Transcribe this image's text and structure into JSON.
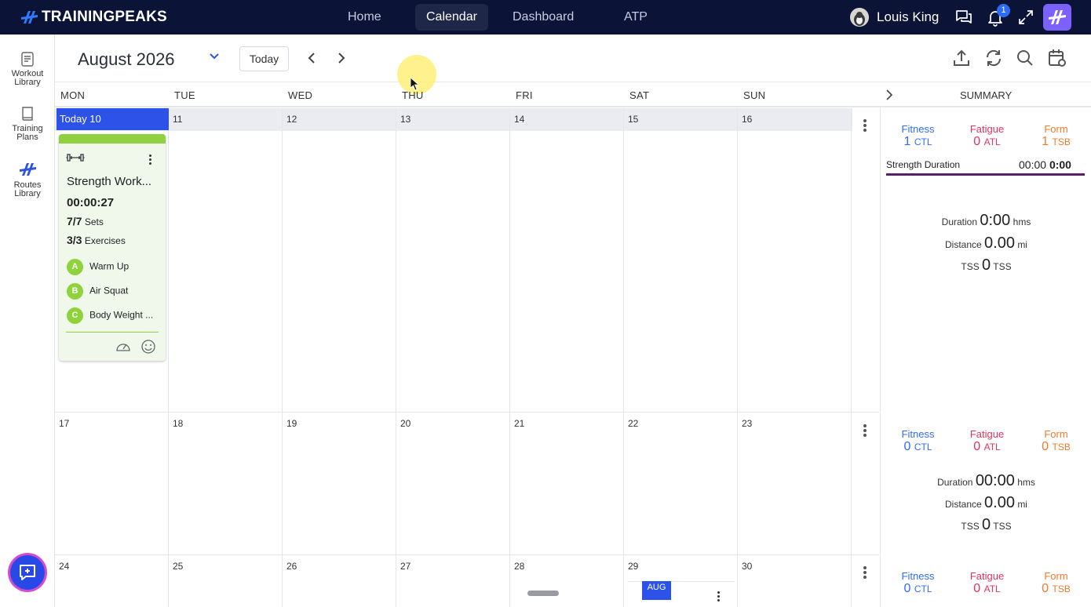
{
  "brand": {
    "name": "TRAININGPEAKS",
    "accent": "#2f6cf6"
  },
  "nav": {
    "items": [
      {
        "label": "Home",
        "active": false
      },
      {
        "label": "Calendar",
        "active": true
      },
      {
        "label": "Dashboard",
        "active": false
      },
      {
        "label": "ATP",
        "active": false
      }
    ],
    "user_name": "Louis King",
    "notification_count": "1"
  },
  "rail": {
    "items": [
      {
        "label_1": "Workout",
        "label_2": "Library",
        "icon": "workout-library-icon"
      },
      {
        "label_1": "Training",
        "label_2": "Plans",
        "icon": "book-icon"
      },
      {
        "label_1": "Routes",
        "label_2": "Library",
        "icon": "routes-icon"
      }
    ]
  },
  "toolbar": {
    "month": "August 2026",
    "today_label": "Today"
  },
  "days": [
    "MON",
    "TUE",
    "WED",
    "THU",
    "FRI",
    "SAT",
    "SUN"
  ],
  "summary_label": "SUMMARY",
  "weeks": [
    {
      "dates": [
        "Today 10",
        "11",
        "12",
        "13",
        "14",
        "15",
        "16"
      ],
      "fitness": "1",
      "fatigue": "0",
      "form": "1",
      "duration": "0:00",
      "distance": "0.00",
      "tss": "0",
      "strength_label": "Strength Duration",
      "strength_value": "00:00",
      "strength_total": "0:00"
    },
    {
      "dates": [
        "17",
        "18",
        "19",
        "20",
        "21",
        "22",
        "23"
      ],
      "fitness": "0",
      "fatigue": "0",
      "form": "0",
      "duration": "00:00",
      "distance": "0.00",
      "tss": "0"
    },
    {
      "dates": [
        "24",
        "25",
        "26",
        "27",
        "28",
        "29",
        "30"
      ],
      "fitness": "0",
      "fatigue": "0",
      "form": "0"
    }
  ],
  "metric_labels": {
    "fitness": "Fitness",
    "fitness_unit": "CTL",
    "fatigue": "Fatigue",
    "fatigue_unit": "ATL",
    "form": "Form",
    "form_unit": "TSB",
    "duration": "Duration",
    "duration_unit": "hms",
    "distance": "Distance",
    "distance_unit": "mi",
    "tss": "TSS",
    "tss_unit": "TSS"
  },
  "workout": {
    "title": "Strength Work...",
    "duration": "00:00:27",
    "sets_value": "7/7",
    "sets_label": "Sets",
    "exercises_value": "3/3",
    "exercises_label": "Exercises",
    "items": [
      {
        "letter": "A",
        "name": "Warm Up"
      },
      {
        "letter": "B",
        "name": "Air Squat"
      },
      {
        "letter": "C",
        "name": "Body Weight ..."
      }
    ]
  },
  "next_month_chip": "AUG"
}
